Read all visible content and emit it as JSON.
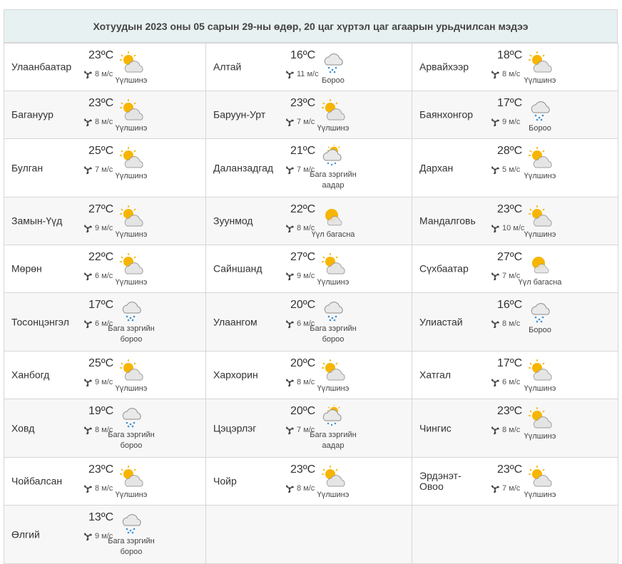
{
  "title": "Хотуудын 2023 оны 05 сарын 29-ны өдөр, 20 цаг хүртэл цаг агаарын урьдчилсан мэдээ",
  "cities": [
    {
      "name": "Улаанбаатар",
      "temp": "23",
      "wind": "8 м/с",
      "desc": "Үүлшинэ",
      "icon": "partly-cloudy"
    },
    {
      "name": "Алтай",
      "temp": "16",
      "wind": "11 м/с",
      "desc": "Бороо",
      "icon": "rain"
    },
    {
      "name": "Арвайхээр",
      "temp": "18",
      "wind": "8 м/с",
      "desc": "Үүлшинэ",
      "icon": "partly-cloudy"
    },
    {
      "name": "Багануур",
      "temp": "23",
      "wind": "8 м/с",
      "desc": "Үүлшинэ",
      "icon": "partly-cloudy"
    },
    {
      "name": "Баруун-Урт",
      "temp": "23",
      "wind": "7 м/с",
      "desc": "Үүлшинэ",
      "icon": "partly-cloudy"
    },
    {
      "name": "Баянхонгор",
      "temp": "17",
      "wind": "9 м/с",
      "desc": "Бороо",
      "icon": "rain"
    },
    {
      "name": "Булган",
      "temp": "25",
      "wind": "7 м/с",
      "desc": "Үүлшинэ",
      "icon": "partly-cloudy"
    },
    {
      "name": "Даланзадгад",
      "temp": "21",
      "wind": "7 м/с",
      "desc": "Бага зэргийн аадар",
      "icon": "sun-shower"
    },
    {
      "name": "Дархан",
      "temp": "28",
      "wind": "5 м/с",
      "desc": "Үүлшинэ",
      "icon": "partly-cloudy"
    },
    {
      "name": "Замын-Үүд",
      "temp": "27",
      "wind": "9 м/с",
      "desc": "Үүлшинэ",
      "icon": "partly-cloudy"
    },
    {
      "name": "Зуунмод",
      "temp": "22",
      "wind": "8 м/с",
      "desc": "Үүл багасна",
      "icon": "mostly-sunny"
    },
    {
      "name": "Мандалговь",
      "temp": "23",
      "wind": "10 м/с",
      "desc": "Үүлшинэ",
      "icon": "partly-cloudy"
    },
    {
      "name": "Мөрөн",
      "temp": "22",
      "wind": "6 м/с",
      "desc": "Үүлшинэ",
      "icon": "partly-cloudy"
    },
    {
      "name": "Сайншанд",
      "temp": "27",
      "wind": "9 м/с",
      "desc": "Үүлшинэ",
      "icon": "partly-cloudy"
    },
    {
      "name": "Сүхбаатар",
      "temp": "27",
      "wind": "7 м/с",
      "desc": "Үүл багасна",
      "icon": "mostly-sunny"
    },
    {
      "name": "Тосонцэнгэл",
      "temp": "17",
      "wind": "6 м/с",
      "desc": "Бага зэргийн бороо",
      "icon": "rain-light"
    },
    {
      "name": "Улаангом",
      "temp": "20",
      "wind": "6 м/с",
      "desc": "Бага зэргийн бороо",
      "icon": "rain-light"
    },
    {
      "name": "Улиастай",
      "temp": "16",
      "wind": "8 м/с",
      "desc": "Бороо",
      "icon": "rain"
    },
    {
      "name": "Ханбогд",
      "temp": "25",
      "wind": "9 м/с",
      "desc": "Үүлшинэ",
      "icon": "partly-cloudy"
    },
    {
      "name": "Хархорин",
      "temp": "20",
      "wind": "8 м/с",
      "desc": "Үүлшинэ",
      "icon": "partly-cloudy"
    },
    {
      "name": "Хатгал",
      "temp": "17",
      "wind": "6 м/с",
      "desc": "Үүлшинэ",
      "icon": "partly-cloudy"
    },
    {
      "name": "Ховд",
      "temp": "19",
      "wind": "8 м/с",
      "desc": "Бага зэргийн бороо",
      "icon": "rain-light"
    },
    {
      "name": "Цэцэрлэг",
      "temp": "20",
      "wind": "7 м/с",
      "desc": "Бага зэргийн аадар",
      "icon": "sun-shower"
    },
    {
      "name": "Чингис",
      "temp": "23",
      "wind": "8 м/с",
      "desc": "Үүлшинэ",
      "icon": "partly-cloudy"
    },
    {
      "name": "Чойбалсан",
      "temp": "23",
      "wind": "8 м/с",
      "desc": "Үүлшинэ",
      "icon": "partly-cloudy"
    },
    {
      "name": "Чойр",
      "temp": "23",
      "wind": "8 м/с",
      "desc": "Үүлшинэ",
      "icon": "partly-cloudy"
    },
    {
      "name": "Эрдэнэт-Овоо",
      "temp": "23",
      "wind": "7 м/с",
      "desc": "Үүлшинэ",
      "icon": "partly-cloudy"
    },
    {
      "name": "Өлгий",
      "temp": "13",
      "wind": "9 м/с",
      "desc": "Бага зэргийн бороо",
      "icon": "rain-light"
    }
  ],
  "temp_unit": "ºC",
  "colors": {
    "header_bg": "#e8f1f1",
    "sun": "#f7b500",
    "cloud": "#dcdcdc",
    "rain": "#3d8fd0",
    "border": "#d6d6d6"
  }
}
